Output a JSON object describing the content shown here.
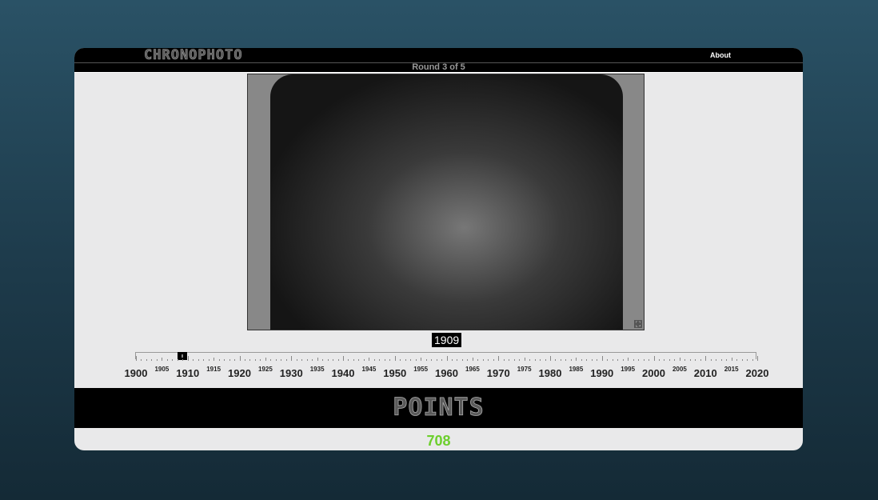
{
  "header": {
    "logo": "CHRONOPHOTO",
    "about_label": "About"
  },
  "round": {
    "text": "Round 3 of 5"
  },
  "photo": {
    "fullscreen_icon": "expand-icon",
    "fullscreen_glyph": "⛶"
  },
  "guess": {
    "year": "1909",
    "value": 1909
  },
  "slider": {
    "min": 1900,
    "max": 2020,
    "labels": [
      "1900",
      "1905",
      "1910",
      "1915",
      "1920",
      "1925",
      "1930",
      "1935",
      "1940",
      "1945",
      "1950",
      "1955",
      "1960",
      "1965",
      "1970",
      "1975",
      "1980",
      "1985",
      "1990",
      "1995",
      "2000",
      "2005",
      "2010",
      "2015",
      "2020"
    ]
  },
  "points": {
    "title": "POINTS",
    "score": "708"
  },
  "colors": {
    "score": "#6ccf2c"
  }
}
